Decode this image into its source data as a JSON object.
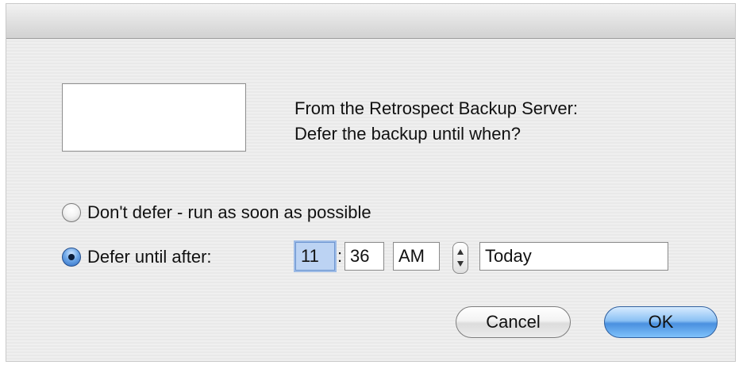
{
  "dialog": {
    "message_line1": "From the Retrospect Backup Server:",
    "message_line2": "Defer the backup until when?"
  },
  "options": {
    "dont_defer_label": "Don't defer - run as soon as possible",
    "defer_label": "Defer until after:",
    "selected": "defer"
  },
  "time": {
    "hour": "11",
    "separator": ":",
    "minute": "36",
    "ampm": "AM",
    "day": "Today"
  },
  "buttons": {
    "cancel": "Cancel",
    "ok": "OK"
  },
  "colors": {
    "accent": "#4a90df",
    "selection": "#bcd3f3"
  }
}
